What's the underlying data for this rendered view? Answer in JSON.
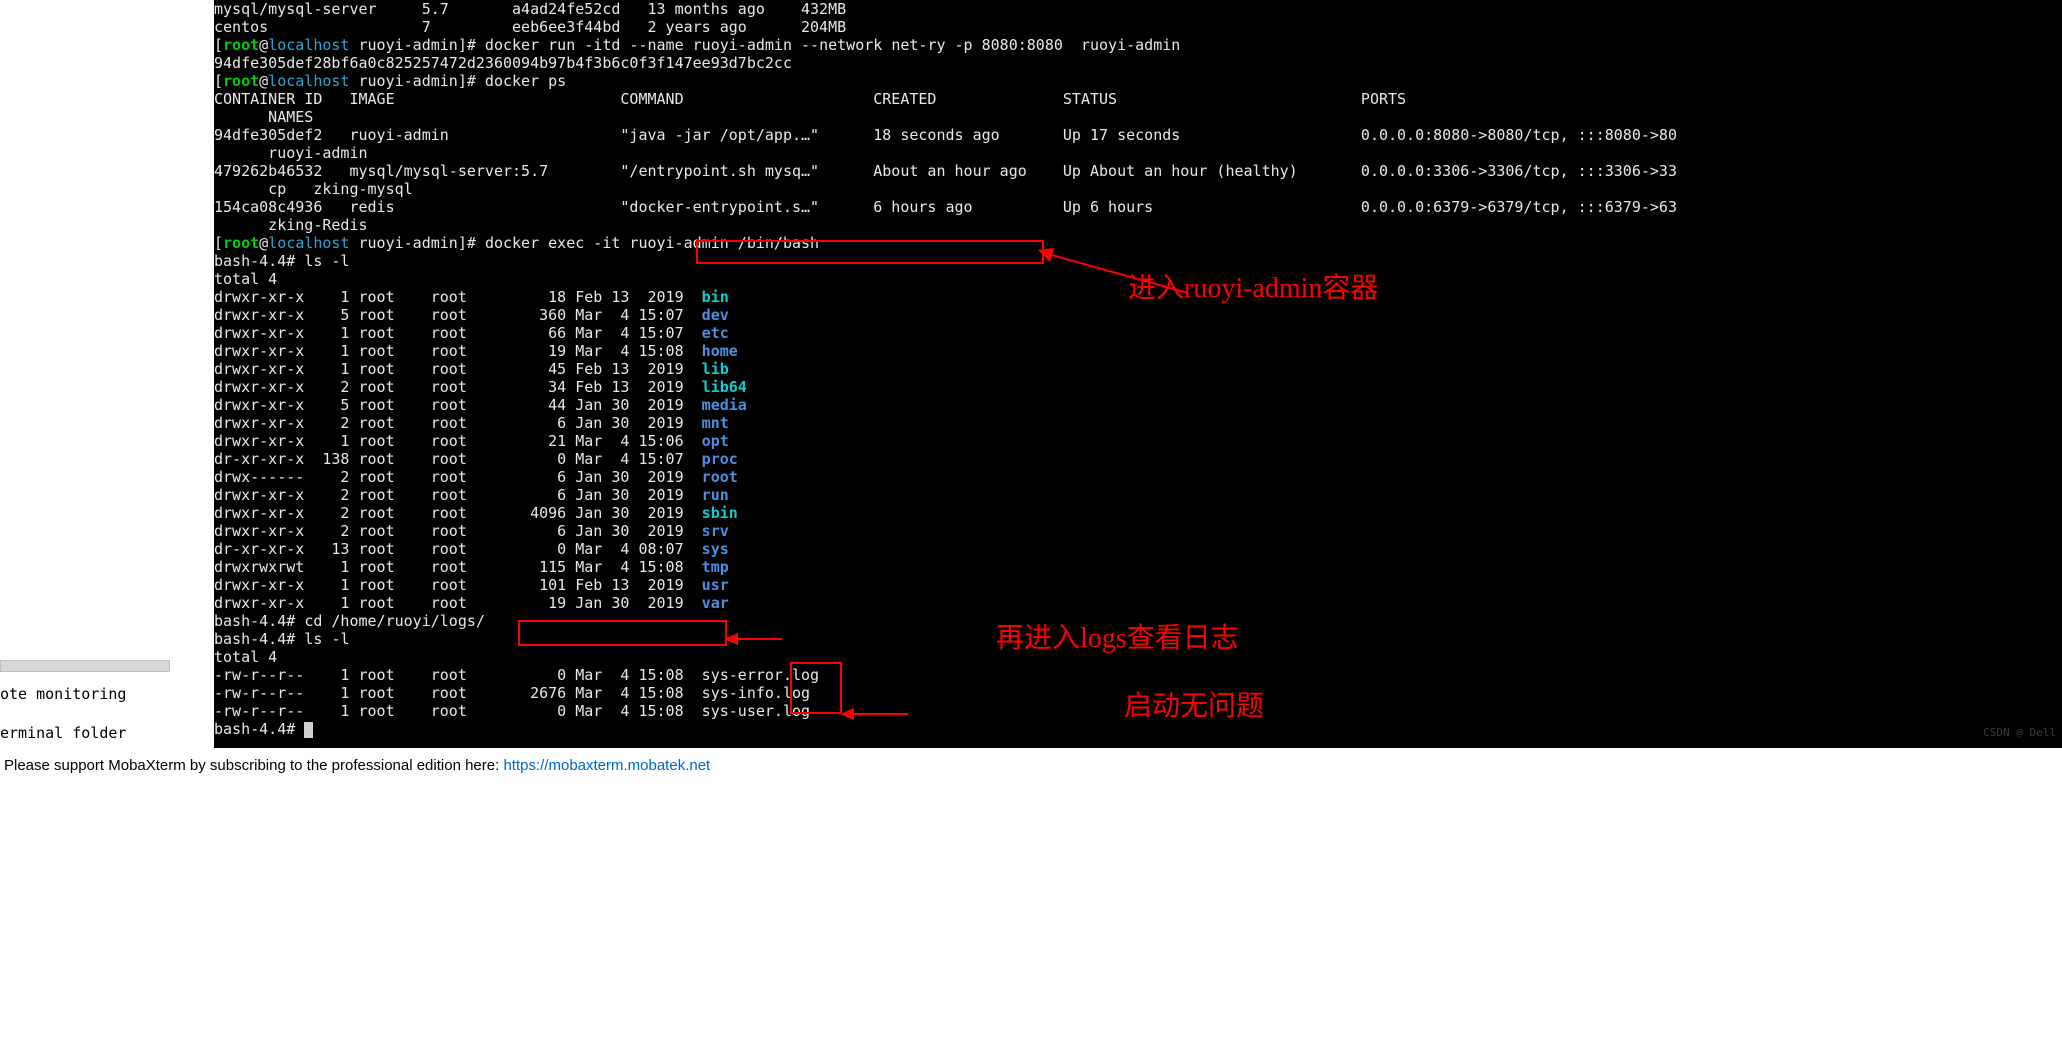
{
  "sidebar": {
    "label1": "ote monitoring",
    "label2": "erminal folder"
  },
  "support": {
    "prefix": "Please support MobaXterm by subscribing to the professional edition here:  ",
    "url": "https://mobaxterm.mobatek.net"
  },
  "watermark": "CSDN @ Dell",
  "annotations": {
    "enter_container": "进入ruoyi-admin容器",
    "view_logs": "再进入logs查看日志",
    "startup_ok": "启动无问题"
  },
  "images_top": [
    {
      "repo": "mysql/mysql-server",
      "tag": "5.7",
      "id": "a4ad24fe52cd",
      "created": "13 months ago",
      "size": "432MB"
    },
    {
      "repo": "centos",
      "tag": "7",
      "id": "eeb6ee3f44bd",
      "created": "2 years ago",
      "size": "204MB"
    }
  ],
  "prompt": {
    "user": "root",
    "host": "localhost",
    "dir": "ruoyi-admin"
  },
  "cmd_run": "docker run -itd --name ruoyi-admin --network net-ry -p 8080:8080  ruoyi-admin",
  "run_output_id": "94dfe305def28bf6a0c825257472d2360094b97b4f3b6c0f3f147ee93d7bc2cc",
  "cmd_ps": "docker ps",
  "ps_header": {
    "container_id": "CONTAINER ID",
    "image": "IMAGE",
    "command": "COMMAND",
    "created": "CREATED",
    "status": "STATUS",
    "ports": "PORTS",
    "names": "NAMES"
  },
  "ps_rows": [
    {
      "id": "94dfe305def2",
      "image": "ruoyi-admin",
      "command": "\"java -jar /opt/app.…\"",
      "created": "18 seconds ago",
      "status": "Up 17 seconds",
      "ports": "0.0.0.0:8080->8080/tcp, :::8080->80",
      "name": "ruoyi-admin"
    },
    {
      "id": "479262b46532",
      "image": "mysql/mysql-server:5.7",
      "command": "\"/entrypoint.sh mysq…\"",
      "created": "About an hour ago",
      "status": "Up About an hour (healthy)",
      "ports": "0.0.0.0:3306->3306/tcp, :::3306->33",
      "name": "cp   zking-mysql"
    },
    {
      "id": "154ca08c4936",
      "image": "redis",
      "command": "\"docker-entrypoint.s…\"",
      "created": "6 hours ago",
      "status": "Up 6 hours",
      "ports": "0.0.0.0:6379->6379/tcp, :::6379->63",
      "name": "zking-Redis"
    }
  ],
  "cmd_exec": "docker exec -it ruoyi-admin /bin/bash",
  "bash_prompt": "bash-4.4#",
  "cmd_ls": "ls -l",
  "ls_total": "total 4",
  "ls_root": [
    {
      "perm": "drwxr-xr-x",
      "links": "1",
      "own": "root",
      "grp": "root",
      "size": "18",
      "date": "Feb 13  2019",
      "name": "bin",
      "cls": "c-brcyan"
    },
    {
      "perm": "drwxr-xr-x",
      "links": "5",
      "own": "root",
      "grp": "root",
      "size": "360",
      "date": "Mar  4 15:07",
      "name": "dev",
      "cls": "c-blue"
    },
    {
      "perm": "drwxr-xr-x",
      "links": "1",
      "own": "root",
      "grp": "root",
      "size": "66",
      "date": "Mar  4 15:07",
      "name": "etc",
      "cls": "c-blue"
    },
    {
      "perm": "drwxr-xr-x",
      "links": "1",
      "own": "root",
      "grp": "root",
      "size": "19",
      "date": "Mar  4 15:08",
      "name": "home",
      "cls": "c-blue"
    },
    {
      "perm": "drwxr-xr-x",
      "links": "1",
      "own": "root",
      "grp": "root",
      "size": "45",
      "date": "Feb 13  2019",
      "name": "lib",
      "cls": "c-brcyan"
    },
    {
      "perm": "drwxr-xr-x",
      "links": "2",
      "own": "root",
      "grp": "root",
      "size": "34",
      "date": "Feb 13  2019",
      "name": "lib64",
      "cls": "c-brcyan"
    },
    {
      "perm": "drwxr-xr-x",
      "links": "5",
      "own": "root",
      "grp": "root",
      "size": "44",
      "date": "Jan 30  2019",
      "name": "media",
      "cls": "c-blue"
    },
    {
      "perm": "drwxr-xr-x",
      "links": "2",
      "own": "root",
      "grp": "root",
      "size": "6",
      "date": "Jan 30  2019",
      "name": "mnt",
      "cls": "c-blue"
    },
    {
      "perm": "drwxr-xr-x",
      "links": "1",
      "own": "root",
      "grp": "root",
      "size": "21",
      "date": "Mar  4 15:06",
      "name": "opt",
      "cls": "c-blue"
    },
    {
      "perm": "dr-xr-xr-x",
      "links": "138",
      "own": "root",
      "grp": "root",
      "size": "0",
      "date": "Mar  4 15:07",
      "name": "proc",
      "cls": "c-blue"
    },
    {
      "perm": "drwx------",
      "links": "2",
      "own": "root",
      "grp": "root",
      "size": "6",
      "date": "Jan 30  2019",
      "name": "root",
      "cls": "c-blue"
    },
    {
      "perm": "drwxr-xr-x",
      "links": "2",
      "own": "root",
      "grp": "root",
      "size": "6",
      "date": "Jan 30  2019",
      "name": "run",
      "cls": "c-blue"
    },
    {
      "perm": "drwxr-xr-x",
      "links": "2",
      "own": "root",
      "grp": "root",
      "size": "4096",
      "date": "Jan 30  2019",
      "name": "sbin",
      "cls": "c-brcyan"
    },
    {
      "perm": "drwxr-xr-x",
      "links": "2",
      "own": "root",
      "grp": "root",
      "size": "6",
      "date": "Jan 30  2019",
      "name": "srv",
      "cls": "c-blue"
    },
    {
      "perm": "dr-xr-xr-x",
      "links": "13",
      "own": "root",
      "grp": "root",
      "size": "0",
      "date": "Mar  4 08:07",
      "name": "sys",
      "cls": "c-blue"
    },
    {
      "perm": "drwxrwxrwt",
      "links": "1",
      "own": "root",
      "grp": "root",
      "size": "115",
      "date": "Mar  4 15:08",
      "name": "tmp",
      "cls": "c-blue"
    },
    {
      "perm": "drwxr-xr-x",
      "links": "1",
      "own": "root",
      "grp": "root",
      "size": "101",
      "date": "Feb 13  2019",
      "name": "usr",
      "cls": "c-blue"
    },
    {
      "perm": "drwxr-xr-x",
      "links": "1",
      "own": "root",
      "grp": "root",
      "size": "19",
      "date": "Jan 30  2019",
      "name": "var",
      "cls": "c-blue"
    }
  ],
  "cmd_cd": "cd /home/ruoyi/logs/",
  "cmd_ls2": "ls -l",
  "ls2_total": "total 4",
  "ls_logs": [
    {
      "perm": "-rw-r--r--",
      "links": "1",
      "own": "root",
      "grp": "root",
      "size": "0",
      "date": "Mar  4 15:08",
      "name": "sys-error.log"
    },
    {
      "perm": "-rw-r--r--",
      "links": "1",
      "own": "root",
      "grp": "root",
      "size": "2676",
      "date": "Mar  4 15:08",
      "name": "sys-info.log"
    },
    {
      "perm": "-rw-r--r--",
      "links": "1",
      "own": "root",
      "grp": "root",
      "size": "0",
      "date": "Mar  4 15:08",
      "name": "sys-user.log"
    }
  ]
}
